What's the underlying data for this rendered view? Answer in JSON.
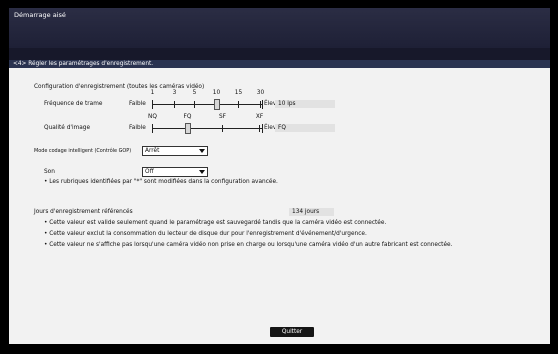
{
  "window": {
    "title": "Démarrage aisé"
  },
  "section": {
    "title": "<4> Régler les paramétrages d'enregistrement."
  },
  "recording_config": {
    "heading": "Configuration d'enregistrement (toutes les caméras vidéo)",
    "frame_rate": {
      "label": "Fréquence de trame",
      "low_label": "Faible",
      "high_label": "Élevé",
      "ticks": [
        "1",
        "3",
        "5",
        "10",
        "15",
        "30"
      ],
      "value": "10 ips",
      "selected_index": 3
    },
    "image_quality": {
      "label": "Qualité d'image",
      "low_label": "Faible",
      "high_label": "Élevé",
      "ticks": [
        "NQ",
        "FQ",
        "SF",
        "XF"
      ],
      "value": "FQ",
      "selected_index": 1
    },
    "smart_coding": {
      "label": "Mode codage intelligent (Contrôle GOP)",
      "value": "Arrêt"
    },
    "sound": {
      "label": "Son",
      "value": "Off"
    },
    "note": "• Les rubriques identifiées par \"*\" sont modifiées dans la configuration avancée."
  },
  "reference_days": {
    "label": "Jours d'enregistrement référencés",
    "value": "134 jours",
    "notes": [
      "• Cette valeur est valide seulement quand le paramétrage est sauvegardé tandis que la caméra vidéo est connectée.",
      "• Cette valeur exclut la consommation du lecteur de disque dur pour l'enregistrement d'événement/d'urgence.",
      "• Cette valeur ne s'affiche pas lorsqu'une caméra vidéo non prise en charge ou lorsqu'une caméra vidéo d'un autre fabricant est connectée."
    ]
  },
  "buttons": {
    "quit": "Quitter"
  },
  "colors": {
    "title_bar": "#2b2d44",
    "section_bar": "#2a3350",
    "panel": "#f2f2f2",
    "button": "#151515"
  }
}
